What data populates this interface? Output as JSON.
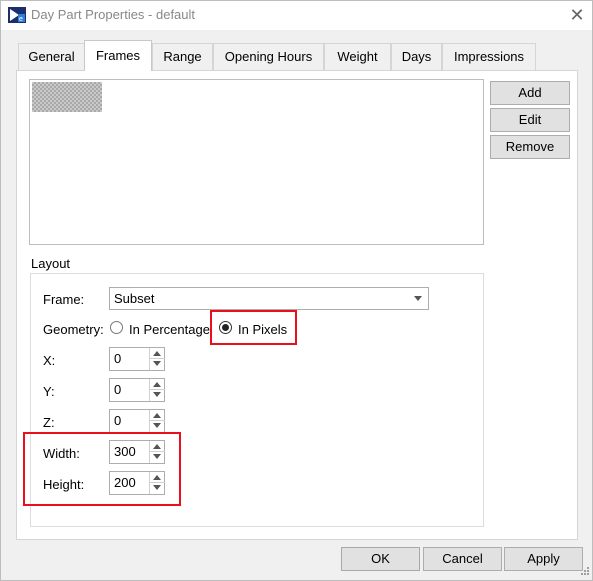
{
  "window": {
    "title": "Day Part Properties - default",
    "close_glyph": "✕",
    "icon": "app-logo-icon"
  },
  "tabs": [
    {
      "label": "General",
      "active": false
    },
    {
      "label": "Frames",
      "active": true
    },
    {
      "label": "Range",
      "active": false
    },
    {
      "label": "Opening Hours",
      "active": false
    },
    {
      "label": "Weight",
      "active": false
    },
    {
      "label": "Days",
      "active": false
    },
    {
      "label": "Impressions",
      "active": false
    }
  ],
  "list_buttons": {
    "add": "Add",
    "edit": "Edit",
    "remove": "Remove"
  },
  "layout": {
    "group_label": "Layout",
    "frame_label": "Frame:",
    "frame_value": "Subset",
    "geometry_label": "Geometry:",
    "geometry_options": [
      {
        "label": "In Percentage",
        "checked": false
      },
      {
        "label": "In Pixels",
        "checked": true
      }
    ],
    "fields": {
      "x": {
        "label": "X:",
        "value": "0"
      },
      "y": {
        "label": "Y:",
        "value": "0"
      },
      "z": {
        "label": "Z:",
        "value": "0"
      },
      "width": {
        "label": "Width:",
        "value": "300"
      },
      "height": {
        "label": "Height:",
        "value": "200"
      }
    }
  },
  "footer": {
    "ok": "OK",
    "cancel": "Cancel",
    "apply": "Apply"
  },
  "colors": {
    "highlight": "#e8101a",
    "window_bg": "#f0f0f0"
  }
}
